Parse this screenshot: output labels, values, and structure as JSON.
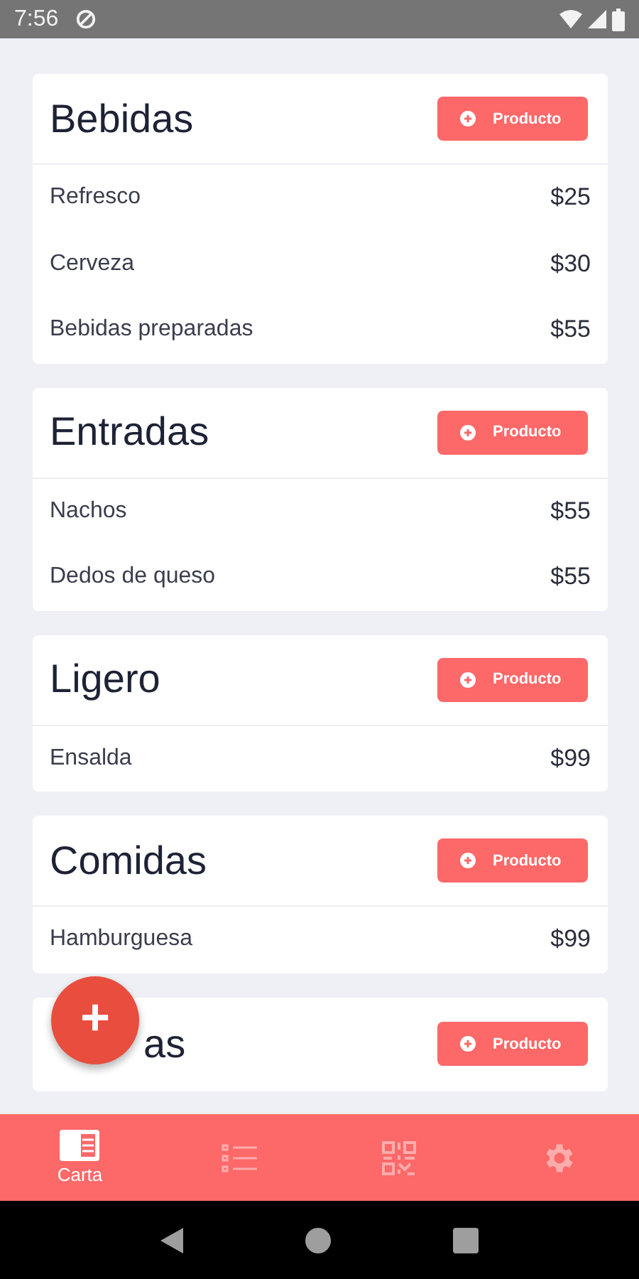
{
  "status_bar": {
    "time": "7:56"
  },
  "sections": [
    {
      "title": "Bebidas",
      "button": "Producto",
      "items": [
        {
          "name": "Refresco",
          "price": "$25"
        },
        {
          "name": "Cerveza",
          "price": "$30"
        },
        {
          "name": "Bebidas preparadas",
          "price": "$55"
        }
      ]
    },
    {
      "title": "Entradas",
      "button": "Producto",
      "items": [
        {
          "name": "Nachos",
          "price": "$55"
        },
        {
          "name": "Dedos de queso",
          "price": "$55"
        }
      ]
    },
    {
      "title": "Ligero",
      "button": "Producto",
      "items": [
        {
          "name": "Ensalda",
          "price": "$99"
        }
      ]
    },
    {
      "title": "Comidas",
      "button": "Producto",
      "items": [
        {
          "name": "Hamburguesa",
          "price": "$99"
        }
      ]
    },
    {
      "title": "as",
      "button": "Producto"
    }
  ],
  "fab": {
    "label": "+"
  },
  "bottom_nav": [
    {
      "kind": "menu",
      "label": "Carta",
      "selected": true
    },
    {
      "kind": "list",
      "selected": false
    },
    {
      "kind": "qr",
      "selected": false
    },
    {
      "kind": "settings",
      "selected": false
    }
  ]
}
